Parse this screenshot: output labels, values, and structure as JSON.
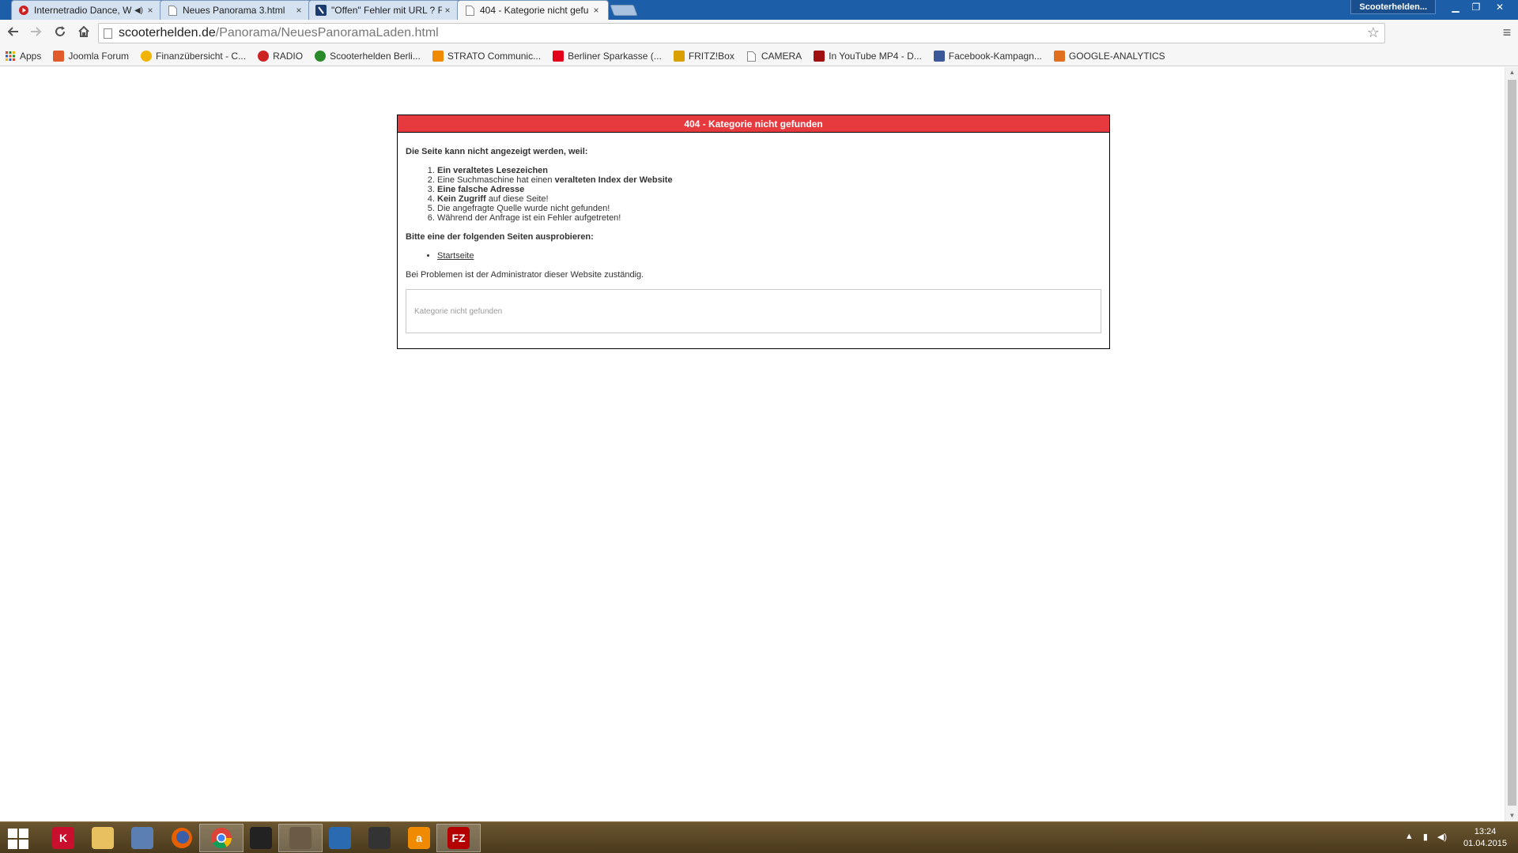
{
  "browser": {
    "tabs": [
      {
        "title": "Internetradio Dance, W",
        "icon": "radio-icon",
        "muted_icon": "speaker-icon",
        "close": "×"
      },
      {
        "title": "Neues Panorama 3.html",
        "icon": "page-icon",
        "close": "×"
      },
      {
        "title": "\"Offen\" Fehler mit URL ? F",
        "icon": "joomla-icon",
        "close": "×"
      },
      {
        "title": "404 - Kategorie nicht gefu",
        "icon": "page-icon",
        "close": "×"
      }
    ],
    "profile_name": "Scooterhelden...",
    "url_host": "scooterhelden.de",
    "url_path": "/Panorama/NeuesPanoramaLaden.html",
    "bookmarks": [
      {
        "label": "Apps",
        "icon": "apps-grid-icon",
        "color": "#d04a2a"
      },
      {
        "label": "Joomla Forum",
        "icon": "joomla-icon",
        "color": "#e05a2a"
      },
      {
        "label": "Finanzübersicht - C...",
        "icon": "finance-icon",
        "color": "#f0b400"
      },
      {
        "label": "RADIO",
        "icon": "radio-icon",
        "color": "#cc2222"
      },
      {
        "label": "Scooterhelden Berli...",
        "icon": "scooter-icon",
        "color": "#2a8a2a"
      },
      {
        "label": "STRATO Communic...",
        "icon": "strato-icon",
        "color": "#f08a00"
      },
      {
        "label": "Berliner Sparkasse (...",
        "icon": "sparkasse-icon",
        "color": "#e2001a"
      },
      {
        "label": "FRITZ!Box",
        "icon": "fritzbox-icon",
        "color": "#d8a000"
      },
      {
        "label": "CAMERA",
        "icon": "page-icon",
        "color": "#ffffff"
      },
      {
        "label": "In YouTube MP4 - D...",
        "icon": "youtube-icon",
        "color": "#a01010"
      },
      {
        "label": "Facebook-Kampagn...",
        "icon": "facebook-icon",
        "color": "#3b5998"
      },
      {
        "label": "GOOGLE-ANALYTICS",
        "icon": "analytics-icon",
        "color": "#e07020"
      }
    ]
  },
  "error": {
    "heading": "404 - Kategorie nicht gefunden",
    "lead": "Die Seite kann nicht angezeigt werden, weil:",
    "reasons": [
      {
        "bold": "Ein veraltetes Lesezeichen",
        "rest": ""
      },
      {
        "pre": "Eine Suchmaschine hat einen ",
        "bold": "veralteten Index der Website",
        "rest": ""
      },
      {
        "bold": "Eine falsche Adresse",
        "rest": ""
      },
      {
        "bold": "Kein Zugriff",
        "rest": " auf diese Seite!"
      },
      {
        "bold": "",
        "rest": "Die angefragte Quelle wurde nicht gefunden!"
      },
      {
        "bold": "",
        "rest": "Während der Anfrage ist ein Fehler aufgetreten!"
      }
    ],
    "try_lead": "Bitte eine der folgenden Seiten ausprobieren:",
    "links": [
      "Startseite"
    ],
    "admin_note": "Bei Problemen ist der Administrator dieser Website zuständig.",
    "message": "Kategorie nicht gefunden",
    "header_color": "#e63a3e"
  },
  "taskbar": {
    "apps": [
      {
        "name": "kaspersky-icon",
        "glyph": "K",
        "color": "#c8102e"
      },
      {
        "name": "file-explorer-icon",
        "glyph": "",
        "color": "#e8c060"
      },
      {
        "name": "scanner-icon",
        "glyph": "",
        "color": "#5a7fb0"
      },
      {
        "name": "firefox-icon",
        "glyph": "",
        "color": "#e66000"
      },
      {
        "name": "chrome-icon",
        "glyph": "",
        "color": "#ffffff",
        "active": true
      },
      {
        "name": "inkscape-icon",
        "glyph": "",
        "color": "#222222"
      },
      {
        "name": "gimp-icon",
        "glyph": "",
        "color": "#6b5a44",
        "active": true
      },
      {
        "name": "pen-tool-icon",
        "glyph": "",
        "color": "#2a6ab0"
      },
      {
        "name": "scissors-icon",
        "glyph": "",
        "color": "#333333"
      },
      {
        "name": "amazon-icon",
        "glyph": "a",
        "color": "#f08a00"
      },
      {
        "name": "filezilla-icon",
        "glyph": "FZ",
        "color": "#b40000",
        "active": true
      }
    ],
    "time": "13:24",
    "date": "01.04.2015"
  }
}
